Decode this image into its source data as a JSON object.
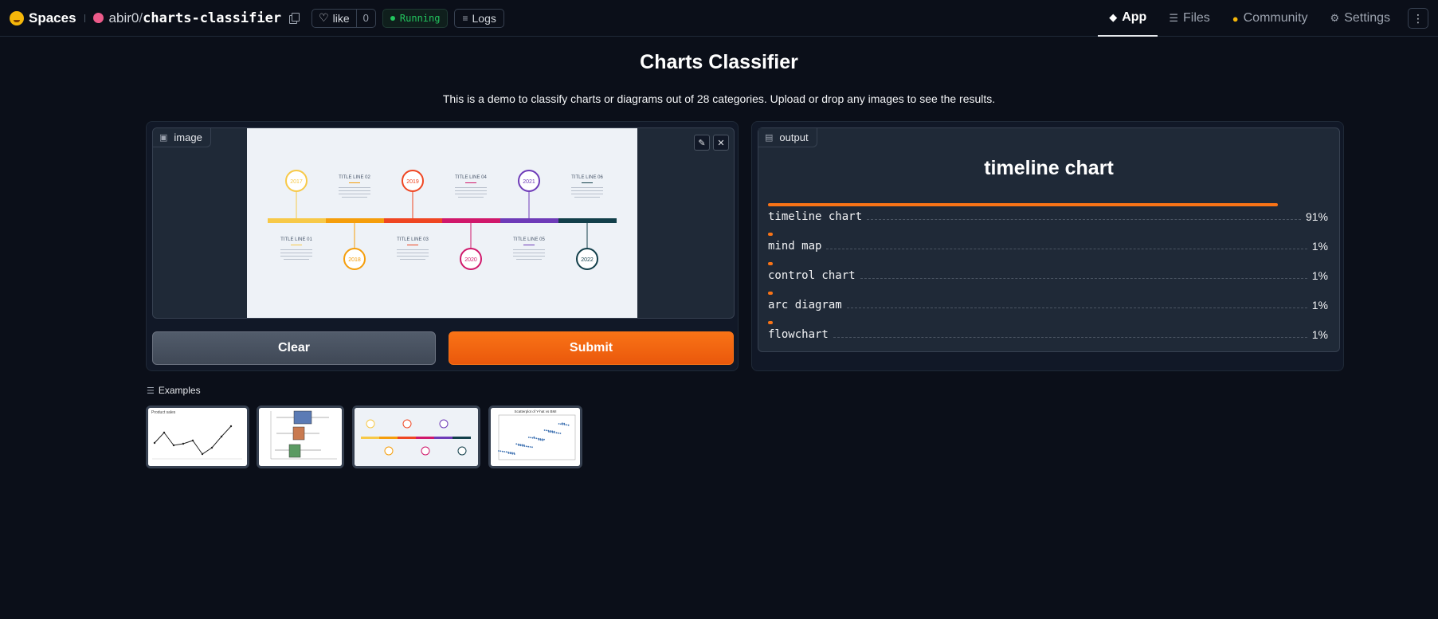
{
  "header": {
    "brand": "Spaces",
    "owner": "abir0",
    "slash": "/",
    "repo": "charts-classifier",
    "like_label": "like",
    "like_count": "0",
    "status": "Running",
    "logs_label": "Logs",
    "nav": [
      {
        "label": "App",
        "icon": "app-cube-icon"
      },
      {
        "label": "Files",
        "icon": "files-icon"
      },
      {
        "label": "Community",
        "icon": "community-icon"
      },
      {
        "label": "Settings",
        "icon": "gear-icon"
      }
    ],
    "status_color": "#22c55e",
    "space_dot_color": "#ec5b8a"
  },
  "main": {
    "title": "Charts Classifier",
    "description": "This is a demo to classify charts or diagrams out of 28 categories. Upload or drop any images to see the results."
  },
  "input": {
    "label": "image",
    "clear_label": "Clear",
    "submit_label": "Submit",
    "preview": {
      "top_titles": [
        "TITLE LINE 02",
        "TITLE LINE 04",
        "TITLE LINE 06"
      ],
      "bottom_titles": [
        "TITLE LINE 01",
        "TITLE LINE 03",
        "TITLE LINE 05"
      ],
      "years": [
        "2017",
        "2018",
        "2019",
        "2020",
        "2021",
        "2022"
      ]
    }
  },
  "output": {
    "label": "output",
    "top_label": "timeline chart",
    "confidences": [
      {
        "label": "timeline chart",
        "value": 0.91,
        "pct": "91%"
      },
      {
        "label": "mind map",
        "value": 0.01,
        "pct": "1%"
      },
      {
        "label": "control chart",
        "value": 0.01,
        "pct": "1%"
      },
      {
        "label": "arc diagram",
        "value": 0.01,
        "pct": "1%"
      },
      {
        "label": "flowchart",
        "value": 0.01,
        "pct": "1%"
      }
    ],
    "bar_color": "#f97316"
  },
  "examples": {
    "label": "Examples",
    "items": [
      {
        "kind": "line chart",
        "caption": "Product sales"
      },
      {
        "kind": "box plot"
      },
      {
        "kind": "timeline chart"
      },
      {
        "kind": "scatter plot",
        "caption": "Scatterplot of Y-hat vs BMI"
      }
    ]
  }
}
